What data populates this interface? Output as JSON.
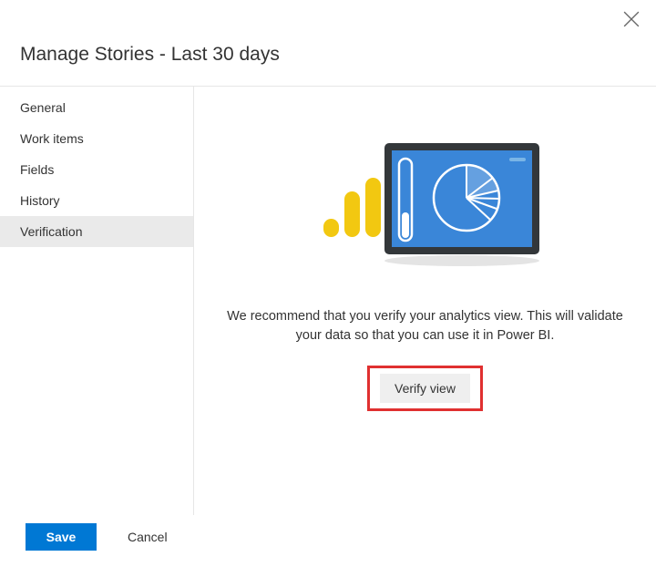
{
  "header": {
    "title": "Manage Stories - Last 30 days"
  },
  "sidebar": {
    "items": [
      {
        "label": "General"
      },
      {
        "label": "Work items"
      },
      {
        "label": "Fields"
      },
      {
        "label": "History"
      },
      {
        "label": "Verification"
      }
    ],
    "selectedIndex": 4
  },
  "main": {
    "recommendation": "We recommend that you verify your analytics view. This will validate your data so that you can use it in Power BI.",
    "verify_label": "Verify view"
  },
  "footer": {
    "save_label": "Save",
    "cancel_label": "Cancel"
  },
  "icons": {
    "close": "close-icon",
    "illustration": "analytics-illustration"
  }
}
